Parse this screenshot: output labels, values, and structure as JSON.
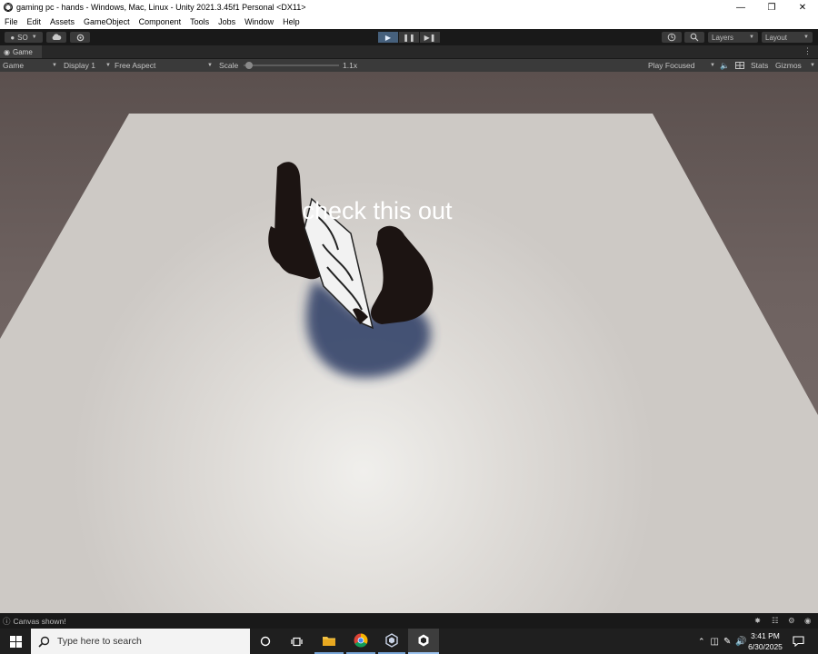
{
  "window": {
    "title": "gaming pc - hands - Windows, Mac, Linux - Unity 2021.3.45f1 Personal <DX11>",
    "controls": [
      "minimize-icon",
      "maximize-icon",
      "close-icon"
    ]
  },
  "menu": [
    "File",
    "Edit",
    "Assets",
    "GameObject",
    "Component",
    "Tools",
    "Jobs",
    "Window",
    "Help"
  ],
  "toolbar": {
    "account_label": "SO",
    "layers_label": "Layers",
    "layout_label": "Layout",
    "play_state": "playing"
  },
  "panel": {
    "tab_label": "Game"
  },
  "gamebar": {
    "mode_label": "Game",
    "display_label": "Display 1",
    "aspect_label": "Free Aspect",
    "scale_label": "Scale",
    "scale_value": "1.1x",
    "scale_fraction": 0.02,
    "play_focused_label": "Play Focused",
    "stats_label": "Stats",
    "gizmos_label": "Gizmos"
  },
  "scene": {
    "overlay_text": "check this out",
    "colors": {
      "background": "#6b5f5d",
      "floor": "#d3d0cc",
      "floor_highlight": "#ecebe8",
      "hands": "#1c1412",
      "shadow": "#2b3a63"
    }
  },
  "status": {
    "message": "Canvas shown!"
  },
  "taskbar": {
    "search_placeholder": "Type here to search",
    "time": "3:41 PM",
    "date": "6/30/2025"
  }
}
